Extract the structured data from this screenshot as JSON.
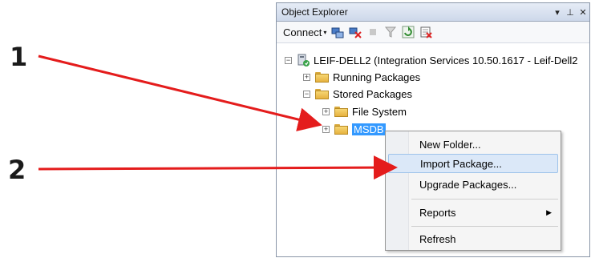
{
  "callouts": {
    "one": "1",
    "two": "2"
  },
  "panel": {
    "title": "Object Explorer",
    "controls": {
      "dropdown": "▾",
      "pin": "⊥",
      "close": "✕"
    }
  },
  "toolbar": {
    "connect_label": "Connect",
    "connect_caret": "▾"
  },
  "tree": {
    "server_label": "LEIF-DELL2 (Integration Services 10.50.1617 - Leif-Dell2",
    "running_packages": "Running Packages",
    "stored_packages": "Stored Packages",
    "file_system": "File System",
    "msdb": "MSDB"
  },
  "context_menu": {
    "new_folder": "New Folder...",
    "import_package": "Import Package...",
    "upgrade_packages": "Upgrade Packages...",
    "reports": "Reports",
    "reports_arrow": "▶",
    "refresh": "Refresh"
  },
  "colors": {
    "arrow": "#e41c1c",
    "selection": "#3399ff"
  }
}
